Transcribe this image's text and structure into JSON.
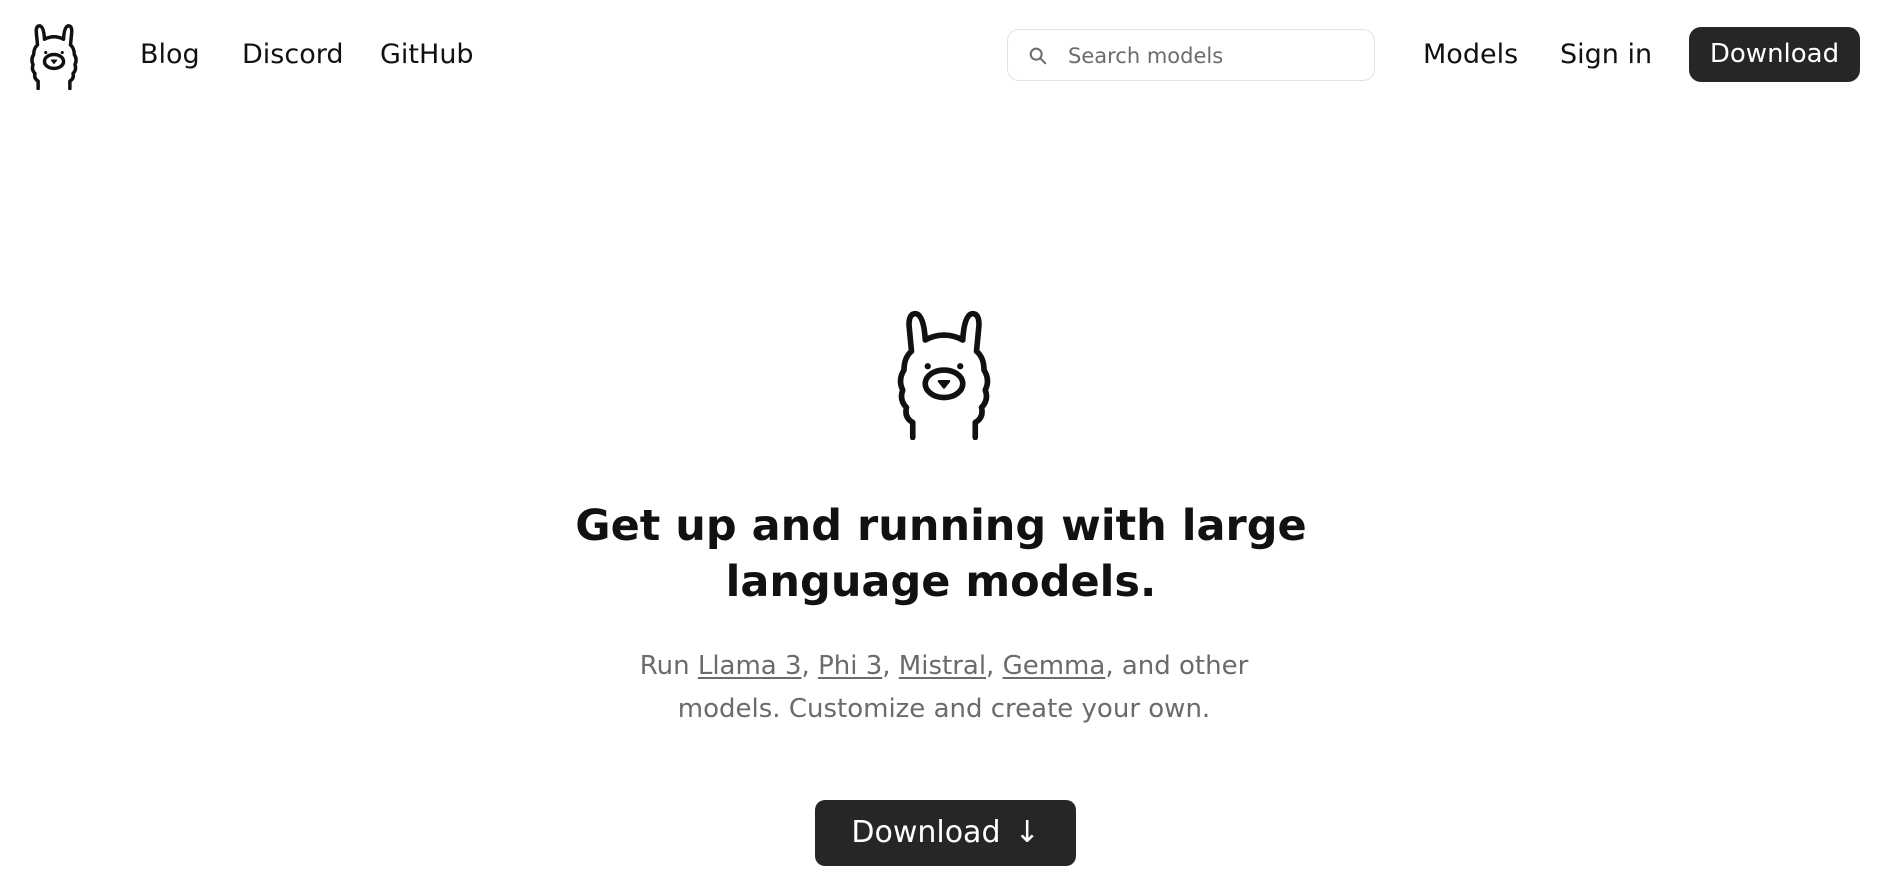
{
  "header": {
    "logo_icon": "llama-icon",
    "nav": {
      "blog": "Blog",
      "discord": "Discord",
      "github": "GitHub"
    },
    "search": {
      "placeholder": "Search models",
      "icon": "search-icon"
    },
    "models": "Models",
    "sign_in": "Sign in",
    "download": "Download"
  },
  "hero": {
    "logo_icon": "llama-icon",
    "headline_line1": "Get up and running with large",
    "headline_line2": "language models.",
    "subtext": {
      "run": "Run ",
      "links": [
        "Llama 3",
        "Phi 3",
        "Mistral",
        "Gemma"
      ],
      "sep": ", ",
      "tail_line1": ", and other",
      "tail_line2": "models. Customize and create your own."
    },
    "download_label": "Download",
    "download_icon": "arrow-down-icon",
    "download_arrow": "↓"
  },
  "colors": {
    "button_bg": "#262626",
    "text": "#111111",
    "muted_text": "#6b6b6b",
    "search_border": "#e2e2e2"
  }
}
